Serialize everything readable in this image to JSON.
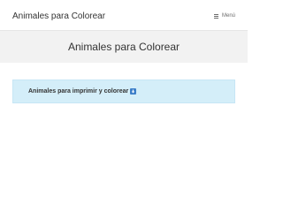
{
  "header": {
    "site_title": "Animales para Colorear",
    "menu_label": "Menú",
    "menu_icon": "hamburger-icon"
  },
  "hero": {
    "page_title": "Animales para Colorear"
  },
  "notice": {
    "link_text": "Animales para imprimir y colorear",
    "icon": "down-arrow-icon",
    "background": "#d4eef9",
    "icon_color": "#3d7fc9"
  }
}
